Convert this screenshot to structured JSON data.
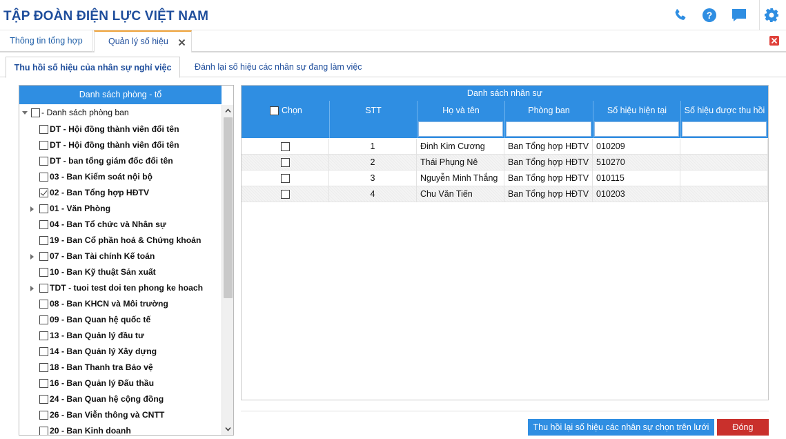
{
  "header": {
    "title": "TẬP ĐOÀN ĐIỆN LỰC VIỆT NAM",
    "icons": [
      "phone-icon",
      "help-icon",
      "chat-icon",
      "settings-icon"
    ],
    "accent": "#1f4e9c"
  },
  "tabs": [
    {
      "label": "Thông tin tổng hợp",
      "active": false
    },
    {
      "label": "Quản lý số hiệu",
      "active": true
    }
  ],
  "subtabs": [
    {
      "label": "Thu hồi số hiệu của nhân sự nghỉ việc",
      "active": true
    },
    {
      "label": "Đánh lại số hiệu các nhân sự đang làm việc",
      "active": false
    }
  ],
  "left_panel": {
    "title": "Danh sách phòng - tổ",
    "root_label": "- Danh sách phòng ban",
    "items": [
      {
        "label": "DT - Hội đồng thành viên đổi tên",
        "checked": false,
        "expandable": false
      },
      {
        "label": "DT - Hội đồng thành viên đổi tên",
        "checked": false,
        "expandable": false
      },
      {
        "label": "DT - ban tổng giám đốc đổi tên",
        "checked": false,
        "expandable": false
      },
      {
        "label": "03 - Ban Kiểm soát nội bộ",
        "checked": false,
        "expandable": false
      },
      {
        "label": "02 - Ban Tổng hợp HĐTV",
        "checked": true,
        "expandable": false
      },
      {
        "label": "01 - Văn Phòng",
        "checked": false,
        "expandable": true
      },
      {
        "label": "04 - Ban Tổ chức và Nhân sự",
        "checked": false,
        "expandable": false
      },
      {
        "label": "19 - Ban Cổ phần hoá & Chứng khoán",
        "checked": false,
        "expandable": false
      },
      {
        "label": "07 - Ban Tài chính Kế toán",
        "checked": false,
        "expandable": true
      },
      {
        "label": "10 - Ban Kỹ thuật Sản xuất",
        "checked": false,
        "expandable": false
      },
      {
        "label": "TDT - tuoi test doi ten phong ke hoach",
        "checked": false,
        "expandable": true
      },
      {
        "label": "08 - Ban KHCN và Môi trường",
        "checked": false,
        "expandable": false
      },
      {
        "label": "09 - Ban Quan hệ quốc tế",
        "checked": false,
        "expandable": false
      },
      {
        "label": "13 - Ban Quản lý đầu tư",
        "checked": false,
        "expandable": false
      },
      {
        "label": "14 - Ban Quản lý Xây dựng",
        "checked": false,
        "expandable": false
      },
      {
        "label": "18 - Ban Thanh tra Bảo vệ",
        "checked": false,
        "expandable": false
      },
      {
        "label": "16 - Ban Quản lý Đấu thầu",
        "checked": false,
        "expandable": false
      },
      {
        "label": "24 - Ban Quan hệ cộng đồng",
        "checked": false,
        "expandable": false
      },
      {
        "label": "26 - Ban Viễn thông và CNTT",
        "checked": false,
        "expandable": false
      },
      {
        "label": "20 - Ban Kinh doanh",
        "checked": false,
        "expandable": false
      }
    ]
  },
  "grid": {
    "title": "Danh sách nhân sự",
    "columns": [
      "Chọn",
      "STT",
      "Họ và tên",
      "Phòng ban",
      "Số hiệu hiện tại",
      "Số hiệu được thu hồi"
    ],
    "rows": [
      {
        "stt": "1",
        "name": "Đinh Kim Cương",
        "dept": "Ban Tổng hợp HĐTV",
        "current": "010209",
        "recovered": ""
      },
      {
        "stt": "2",
        "name": "Thái Phụng Nê",
        "dept": "Ban Tổng hợp HĐTV",
        "current": "510270",
        "recovered": ""
      },
      {
        "stt": "3",
        "name": "Nguyễn Minh Thắng",
        "dept": "Ban Tổng hợp HĐTV",
        "current": "010115",
        "recovered": ""
      },
      {
        "stt": "4",
        "name": "Chu Văn Tiến",
        "dept": "Ban Tổng hợp HĐTV",
        "current": "010203",
        "recovered": ""
      }
    ]
  },
  "buttons": {
    "recover": "Thu hồi lại số hiệu các nhân sự chọn trên lưới",
    "close": "Đóng"
  }
}
